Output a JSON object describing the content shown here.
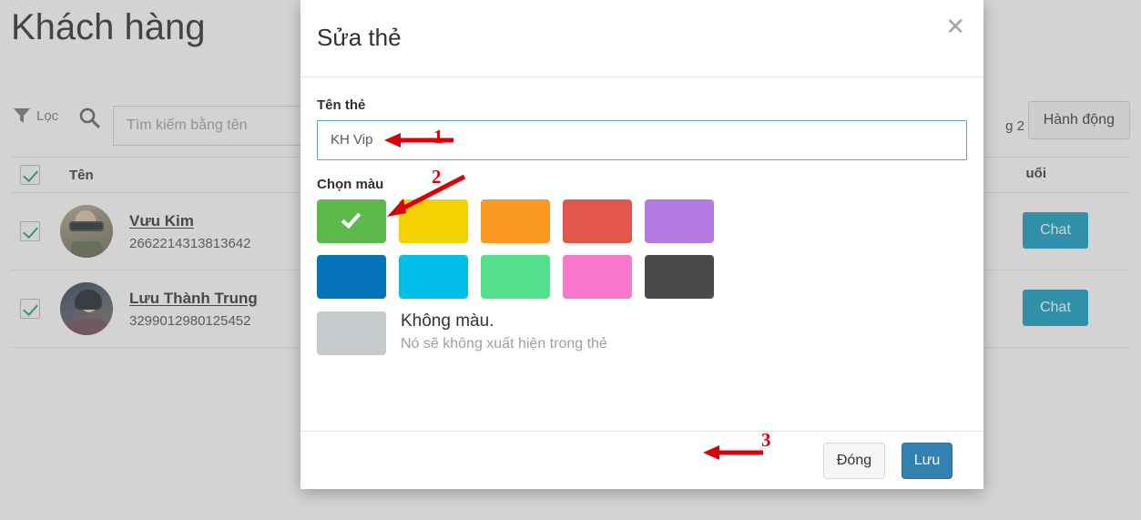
{
  "background_page": {
    "title": "Khách hàng",
    "toolbar": {
      "filter_label": "Lọc",
      "filter_icon": "funnel-icon",
      "search_icon": "search-icon",
      "search_placeholder": "Tìm kiếm bằng tên",
      "search_value": "",
      "page_indicator": "g 2",
      "action_button": "Hành động"
    },
    "table": {
      "headers": {
        "name": "Tên",
        "last": "uối"
      },
      "rows": [
        {
          "name": "Vưu Kim",
          "id": "2662214313813642",
          "chat_label": "Chat",
          "checked": true
        },
        {
          "name": "Lưu Thành Trung",
          "id": "3299012980125452",
          "chat_label": "Chat",
          "checked": true
        }
      ],
      "header_checked": true
    }
  },
  "modal": {
    "title": "Sửa thẻ",
    "close_icon": "close-icon",
    "form": {
      "name_label": "Tên thẻ",
      "name_value": "KH Vip",
      "color_label": "Chọn màu"
    },
    "colors": [
      {
        "name": "green",
        "hex": "#5CBA4C",
        "selected": true
      },
      {
        "name": "yellow",
        "hex": "#F2D202",
        "selected": false
      },
      {
        "name": "orange",
        "hex": "#FB9A22",
        "selected": false
      },
      {
        "name": "red",
        "hex": "#E2574C",
        "selected": false
      },
      {
        "name": "purple",
        "hex": "#B57BE0",
        "selected": false
      },
      {
        "name": "blue",
        "hex": "#0572BC",
        "selected": false
      },
      {
        "name": "cyan",
        "hex": "#00BEE8",
        "selected": false
      },
      {
        "name": "mint",
        "hex": "#55E28C",
        "selected": false
      },
      {
        "name": "pink",
        "hex": "#F978CE",
        "selected": false
      },
      {
        "name": "dark-gray",
        "hex": "#4A4A4A",
        "selected": false
      }
    ],
    "no_color": {
      "swatch_hex": "#C5CACD",
      "title": "Không màu.",
      "subtitle": "Nó sẽ không xuất hiện trong thẻ"
    },
    "footer": {
      "close_label": "Đóng",
      "save_label": "Lưu"
    }
  },
  "annotations": {
    "accent_hex": "#D9000A",
    "markers": [
      {
        "number": "1",
        "points_to": "tag-name-input"
      },
      {
        "number": "2",
        "points_to": "color-swatch-green"
      },
      {
        "number": "3",
        "points_to": "save-button"
      }
    ]
  }
}
